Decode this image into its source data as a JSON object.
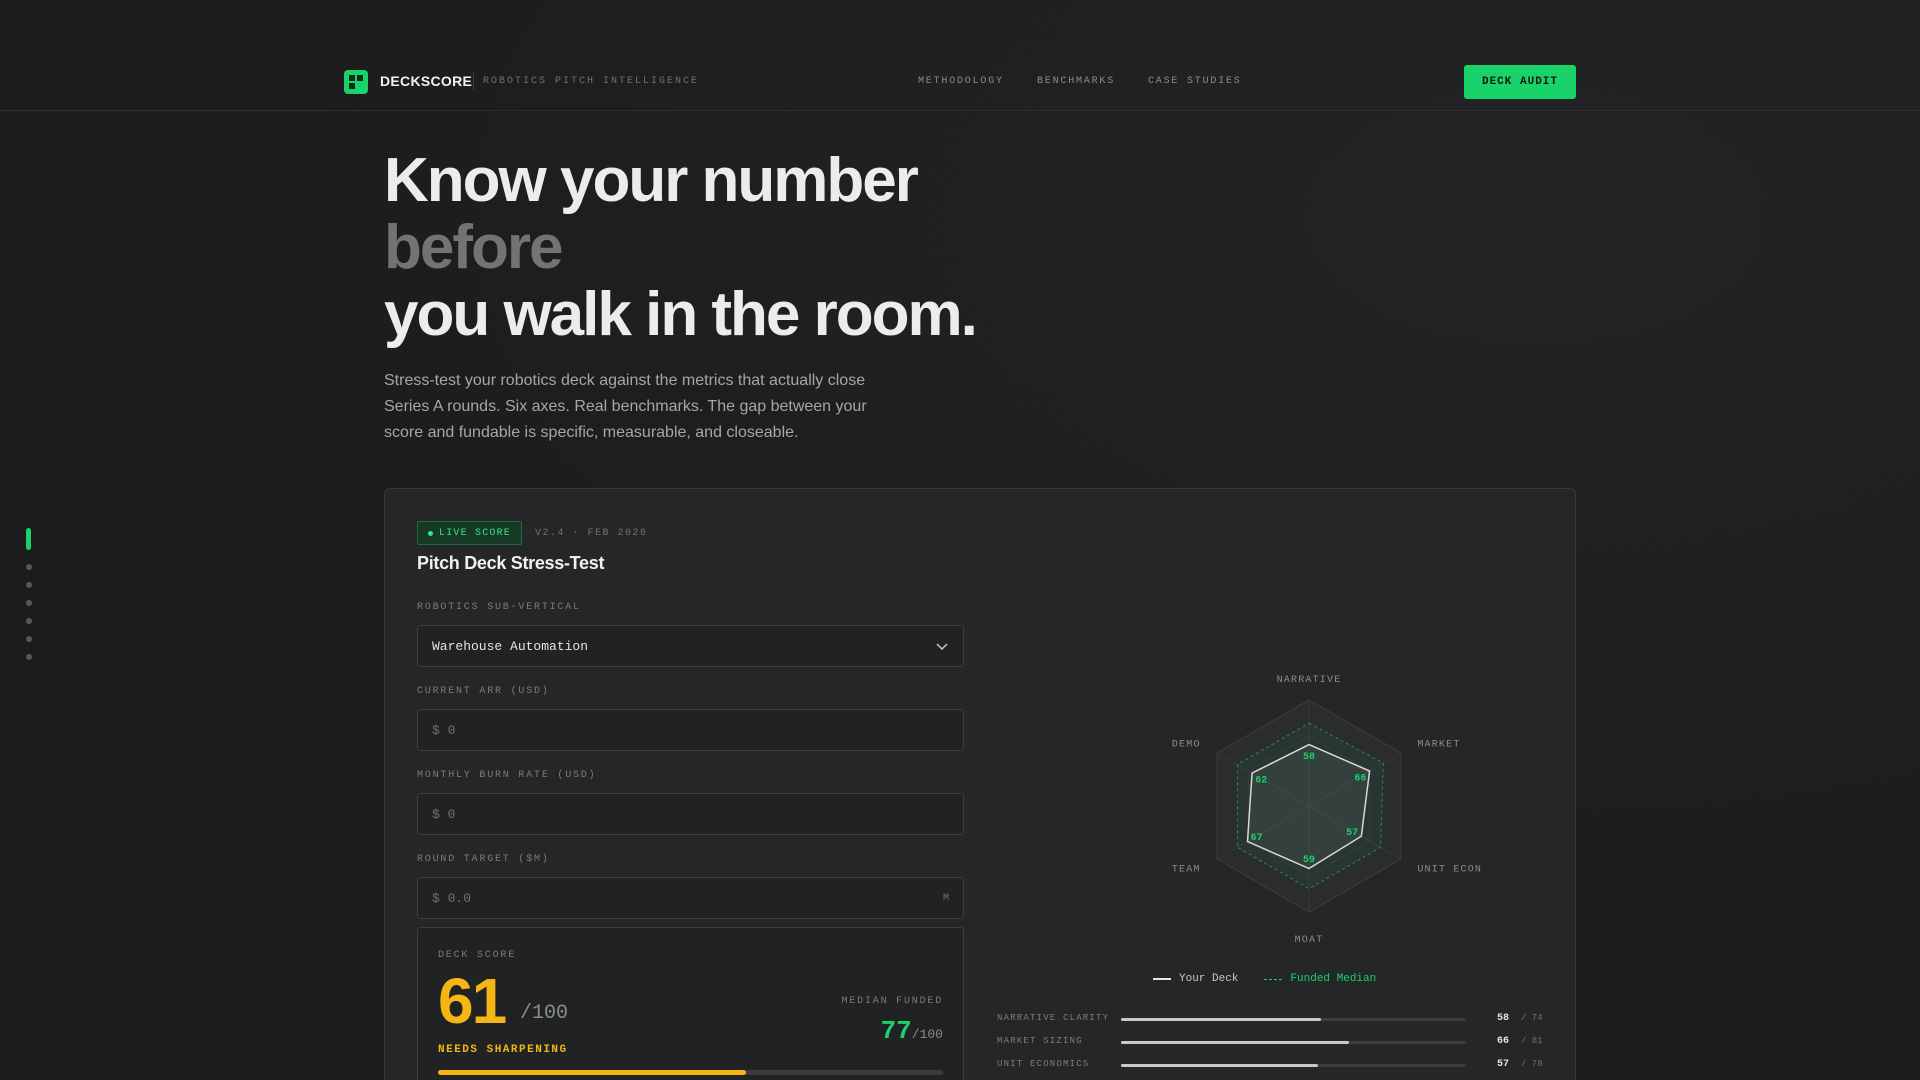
{
  "nav": {
    "brand": "DECKSCORE",
    "tagline": "ROBOTICS PITCH INTELLIGENCE",
    "links": [
      "METHODOLOGY",
      "BENCHMARKS",
      "CASE STUDIES"
    ],
    "cta": "DECK AUDIT"
  },
  "hero": {
    "line1": "Know your number",
    "line2": "before",
    "line3": "you walk in the room.",
    "lede": "Stress-test your robotics deck against the metrics that actually close Series A rounds. Six axes. Real benchmarks. The gap between your score and fundable is specific, measurable, and closeable."
  },
  "card": {
    "badge": "LIVE SCORE",
    "version": "V2.4 · FEB 2026",
    "title": "Pitch Deck Stress-Test",
    "fields": {
      "subvertical_label": "ROBOTICS SUB-VERTICAL",
      "subvertical_value": "Warehouse Automation",
      "arr_label": "CURRENT ARR (USD)",
      "arr_placeholder": "$ 0",
      "burn_label": "MONTHLY BURN RATE (USD)",
      "burn_placeholder": "$ 0",
      "round_label": "ROUND TARGET ($M)",
      "round_placeholder": "$ 0.0",
      "round_suffix": "M"
    },
    "score": {
      "label": "DECK SCORE",
      "value": "61",
      "denom": "/100",
      "status": "NEEDS SHARPENING",
      "median_label": "MEDIAN FUNDED",
      "median_value": "77",
      "median_denom": "/100",
      "progress": 0.61
    },
    "radar": {
      "axes": [
        "NARRATIVE",
        "MARKET",
        "UNIT ECON",
        "MOAT",
        "TEAM",
        "DEMO"
      ],
      "your_deck": [
        58,
        66,
        57,
        59,
        67,
        62
      ],
      "funded_median": [
        78,
        81,
        78,
        78,
        78,
        78
      ],
      "max": 100
    },
    "legend": {
      "yours": "Your Deck",
      "median": "Funded Median"
    },
    "bars": [
      {
        "name": "NARRATIVE CLARITY",
        "value": "58",
        "target": "/ 74",
        "fill": 0.58
      },
      {
        "name": "MARKET SIZING",
        "value": "66",
        "target": "/ 81",
        "fill": 0.66
      },
      {
        "name": "UNIT ECONOMICS",
        "value": "57",
        "target": "/ 78",
        "fill": 0.57
      }
    ]
  },
  "colors": {
    "accent": "#19d26a",
    "warning": "#f5b515"
  }
}
